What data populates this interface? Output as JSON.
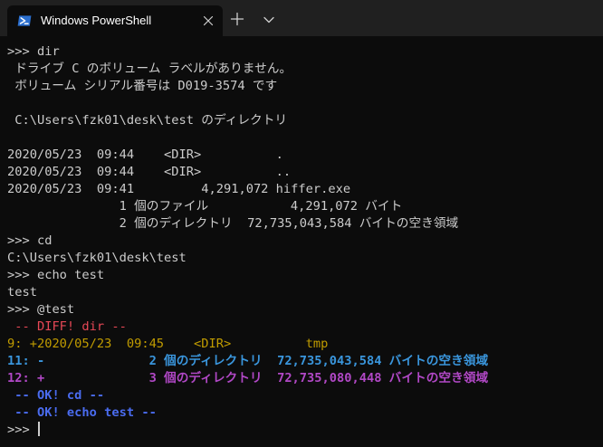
{
  "window": {
    "tab_title": "Windows PowerShell",
    "new_tab_label": "+",
    "dropdown_label": "⌄"
  },
  "terminal": {
    "lines": [
      ">>> dir",
      " ドライブ C のボリューム ラベルがありません。",
      " ボリューム シリアル番号は D019-3574 です",
      "",
      " C:\\Users\\fzk01\\desk\\test のディレクトリ",
      "",
      "2020/05/23  09:44    <DIR>          .",
      "2020/05/23  09:44    <DIR>          ..",
      "2020/05/23  09:41         4,291,072 hiffer.exe",
      "               1 個のファイル           4,291,072 バイト",
      "               2 個のディレクトリ  72,735,043,584 バイトの空き領域",
      ">>> cd",
      "C:\\Users\\fzk01\\desk\\test",
      ">>> echo test",
      "test",
      ">>> @test",
      " -- DIFF! dir --",
      "9: +2020/05/23  09:45    <DIR>          tmp",
      "11: -              2 個のディレクトリ  72,735,043,584 バイトの空き領域",
      "12: +              3 個のディレクトリ  72,735,080,448 バイトの空き領域",
      " -- OK! cd --",
      " -- OK! echo test --"
    ],
    "prompt": ">>> ",
    "colors": {
      "background": "#0c0c0c",
      "foreground": "#cccccc",
      "diff_header": "#e74856",
      "added_line": "#c19c00",
      "removed_line": "#3a96dd",
      "changed_line": "#b148c6",
      "ok_message": "#4a6cf0"
    },
    "icons": {
      "tab": "powershell-icon",
      "close": "close-icon",
      "new_tab": "plus-icon",
      "dropdown": "chevron-down-icon"
    }
  }
}
